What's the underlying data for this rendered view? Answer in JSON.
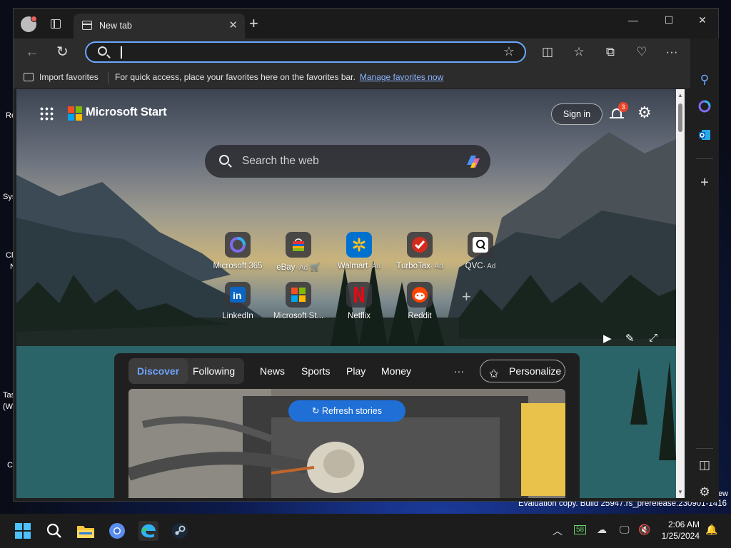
{
  "browser": {
    "tab_title": "New tab",
    "address_value": "",
    "favorites_bar": {
      "import_label": "Import favorites",
      "message": "For quick access, place your favorites here on the favorites bar.",
      "manage_link": "Manage favorites now"
    }
  },
  "start_page": {
    "brand": "Microsoft Start",
    "sign_in": "Sign in",
    "notification_count": "3",
    "search_placeholder": "Search the web",
    "tiles": [
      {
        "label": "Microsoft 365",
        "ad": ""
      },
      {
        "label": "eBay",
        "ad": "· Ad"
      },
      {
        "label": "Walmart",
        "ad": "· Ad"
      },
      {
        "label": "TurboTax",
        "ad": "· Ad"
      },
      {
        "label": "QVC",
        "ad": "· Ad"
      },
      {
        "label": "LinkedIn",
        "ad": ""
      },
      {
        "label": "Microsoft St...",
        "ad": ""
      },
      {
        "label": "Netflix",
        "ad": ""
      },
      {
        "label": "Reddit",
        "ad": ""
      }
    ],
    "feed": {
      "tab_discover": "Discover",
      "tab_following": "Following",
      "links": [
        "News",
        "Sports",
        "Play",
        "Money"
      ],
      "more": "···",
      "personalize": "Personalize",
      "refresh": "Refresh stories"
    }
  },
  "desktop": {
    "eval_text": "Evaluation copy. Build 25947.rs_prerelease.230901-1416",
    "eval_partial": "ew",
    "icon_stubs": [
      "Re",
      "Sys",
      "Cl",
      "N",
      "Tas",
      "(W",
      "C"
    ]
  },
  "taskbar": {
    "time": "2:06 AM",
    "date": "1/25/2024",
    "tray_badge": "58"
  }
}
